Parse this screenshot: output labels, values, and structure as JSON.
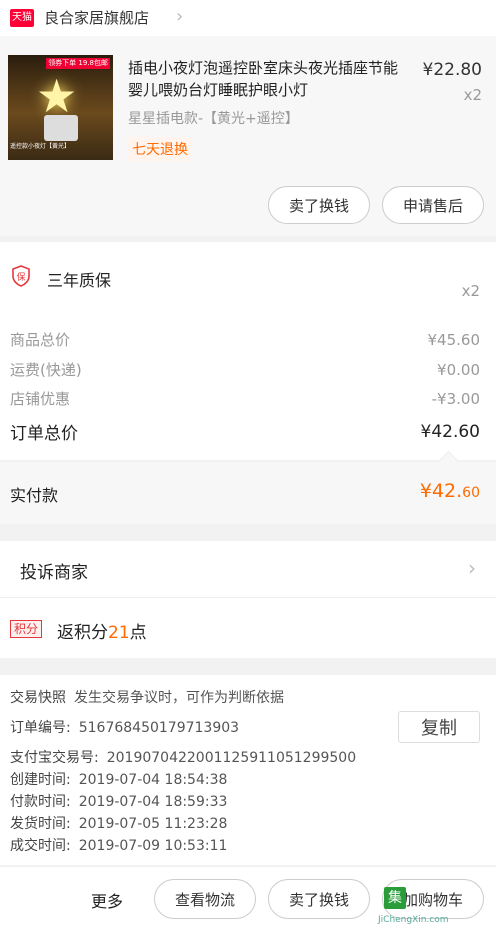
{
  "store": {
    "badge": "天猫",
    "name": "良合家居旗舰店"
  },
  "product": {
    "title": "插电小夜灯泡遥控卧室床头夜光插座节能婴儿喂奶台灯睡眠护眼小灯",
    "price": "¥22.80",
    "qty": "x2",
    "sku": "星星插电款-【黄光+遥控】",
    "return_policy": "七天退换",
    "thumb_tag": "领券下单 19.8包邮",
    "thumb_caption": "遥控款小夜灯【黄光】",
    "buttons": {
      "exchange": "卖了换钱",
      "after_sale": "申请售后"
    }
  },
  "warranty": {
    "badge": "保",
    "label": "三年质保",
    "qty": "x2"
  },
  "totals": {
    "rows": [
      {
        "label": "商品总价",
        "value": "¥45.60"
      },
      {
        "label": "运费(快递)",
        "value": "¥0.00"
      },
      {
        "label": "店铺优惠",
        "value": "-¥3.00"
      }
    ],
    "order_total": {
      "label": "订单总价",
      "value": "¥42.60"
    }
  },
  "paid": {
    "label": "实付款",
    "int": "¥42.",
    "dec": "60"
  },
  "complaint": {
    "label": "投诉商家"
  },
  "points": {
    "badge": "积分",
    "prefix": "返积分",
    "num": "21",
    "suffix": "点"
  },
  "info": {
    "snapshot": {
      "label": "交易快照",
      "value": "发生交易争议时，可作为判断依据"
    },
    "order_no": {
      "label": "订单编号:",
      "value": "516768450179713903"
    },
    "copy": "复制",
    "alipay_no": {
      "label": "支付宝交易号:",
      "value": "2019070422001125911051299500"
    },
    "created": {
      "label": "创建时间:",
      "value": "2019-07-04 18:54:38"
    },
    "paid": {
      "label": "付款时间:",
      "value": "2019-07-04 18:59:33"
    },
    "shipped": {
      "label": "发货时间:",
      "value": "2019-07-05 11:23:28"
    },
    "done": {
      "label": "成交时间:",
      "value": "2019-07-09 10:53:11"
    }
  },
  "footer": {
    "more": "更多",
    "logistics": "查看物流",
    "exchange": "卖了换钱",
    "cart": "加购物车",
    "watermark_icon": "集",
    "watermark_text": "JiChengXin.com"
  }
}
